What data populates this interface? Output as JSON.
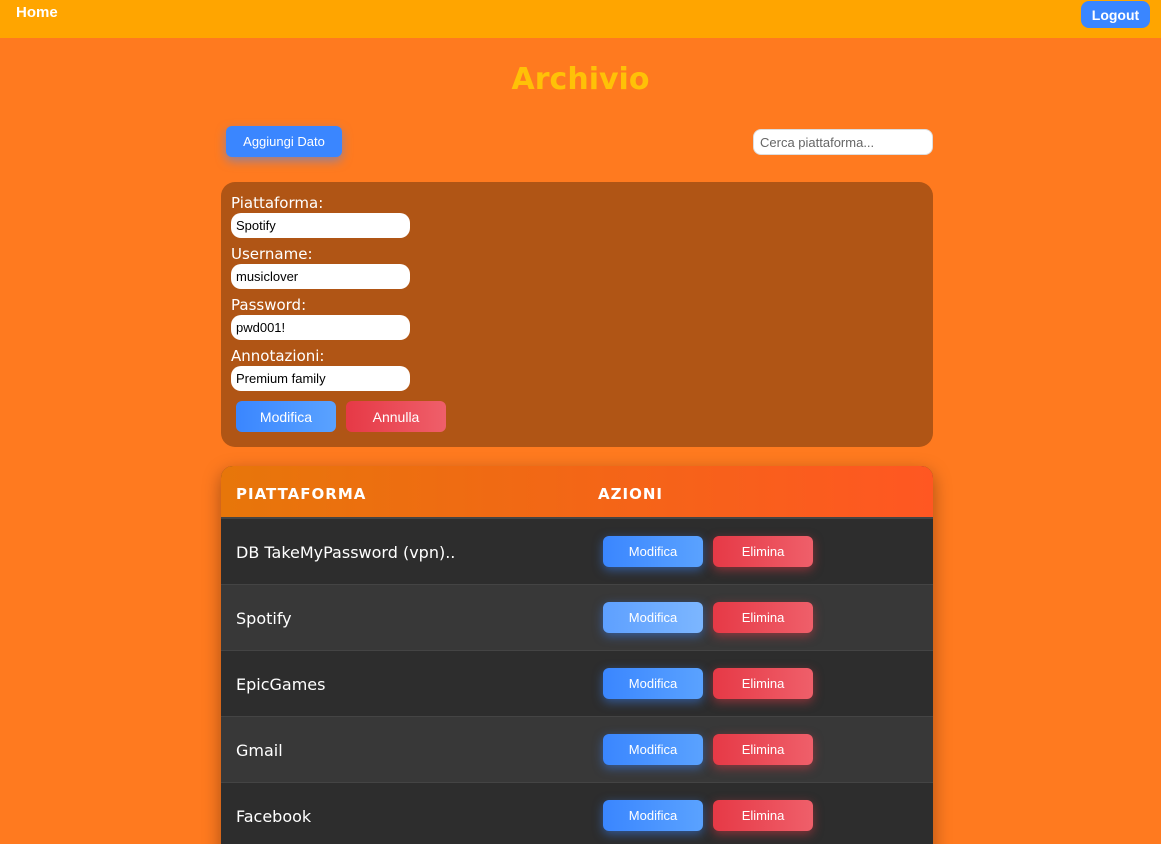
{
  "nav": {
    "home_label": "Home",
    "logout_label": "Logout"
  },
  "page": {
    "title": "Archivio"
  },
  "toolbar": {
    "add_label": "Aggiungi Dato",
    "search_placeholder": "Cerca piattaforma..."
  },
  "edit_form": {
    "platform_label": "Piattaforma:",
    "platform_value": "Spotify",
    "username_label": "Username:",
    "username_value": "musiclover",
    "password_label": "Password:",
    "password_value": "pwd001!",
    "notes_label": "Annotazioni:",
    "notes_value": "Premium family",
    "save_label": "Modifica",
    "cancel_label": "Annulla"
  },
  "table": {
    "headers": [
      "PIATTAFORMA",
      "AZIONI"
    ],
    "edit_label": "Modifica",
    "delete_label": "Elimina",
    "rows": [
      {
        "platform": "DB TakeMyPassword (vpn).."
      },
      {
        "platform": "Spotify"
      },
      {
        "platform": "EpicGames"
      },
      {
        "platform": "Gmail"
      },
      {
        "platform": "Facebook"
      }
    ]
  },
  "colors": {
    "background": "#ff7a1f",
    "navbar": "#ffa500",
    "title": "#ffc107",
    "primary": "#3a86ff",
    "danger": "#e63946"
  }
}
